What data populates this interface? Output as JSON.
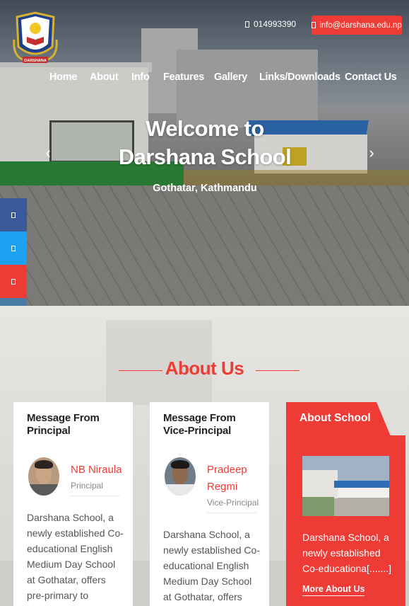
{
  "header": {
    "phone": "014993390",
    "email": "info@darshana.edu.np",
    "logo_text": "DARSHANA"
  },
  "nav": {
    "items": [
      {
        "label": "Home"
      },
      {
        "label": "About"
      },
      {
        "label": "Info"
      },
      {
        "label": "Features"
      },
      {
        "label": "Gallery"
      },
      {
        "label": "Links/Downloads"
      },
      {
        "label": "Contact Us"
      }
    ]
  },
  "hero": {
    "title_line1": "Welcome to",
    "title_line2": "Darshana School",
    "subtitle": "Gothatar, Kathmandu"
  },
  "social": [
    {
      "name": "facebook",
      "color": "#3b5998"
    },
    {
      "name": "twitter",
      "color": "#1da1f2"
    },
    {
      "name": "youtube",
      "color": "#ef3b35"
    },
    {
      "name": "linkedin",
      "color": "#4a7aa6"
    }
  ],
  "about": {
    "section_title": "About Us",
    "cards": [
      {
        "title": "Message From Principal",
        "name": "NB Niraula",
        "role": "Principal",
        "body": "Darshana School, a newly established Co-educational English Medium Day School at Gothatar, offers pre-primary to secondary level course with"
      },
      {
        "title": "Message From Vice-Principal",
        "name": "Pradeep Regmi",
        "role": "Vice-Principal",
        "body": "Darshana School, a newly established Co-educational English Medium Day School at Gothatar, offers pre-primary"
      }
    ],
    "school": {
      "title": "About School",
      "text": "Darshana School, a newly established Co-educationa[.......]",
      "more": "More About Us"
    }
  },
  "colors": {
    "accent": "#ef3b35",
    "nav_text": "#ffffff"
  }
}
